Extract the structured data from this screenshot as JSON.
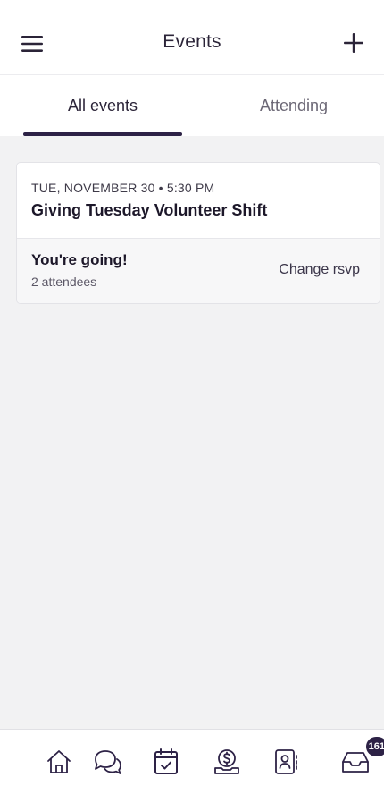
{
  "header": {
    "title": "Events",
    "menu_icon": "hamburger-menu-icon",
    "add_icon": "plus-icon"
  },
  "tabs": [
    {
      "label": "All events",
      "active": true
    },
    {
      "label": "Attending",
      "active": false
    }
  ],
  "events": [
    {
      "date": "TUE, NOVEMBER 30 • 5:30 PM",
      "title": "Giving Tuesday Volunteer Shift",
      "status": "You're going!",
      "attendees": "2 attendees",
      "action": "Change rsvp"
    }
  ],
  "bottom_nav": [
    {
      "icon": "home-icon",
      "active": false
    },
    {
      "icon": "chat-icon",
      "active": false
    },
    {
      "icon": "calendar-check-icon",
      "active": true
    },
    {
      "icon": "donation-icon",
      "active": false
    },
    {
      "icon": "contacts-icon",
      "active": false
    },
    {
      "icon": "inbox-icon",
      "active": false,
      "badge": "161"
    }
  ],
  "colors": {
    "accent": "#2d2246",
    "background": "#f2f2f3",
    "card": "#ffffff"
  }
}
